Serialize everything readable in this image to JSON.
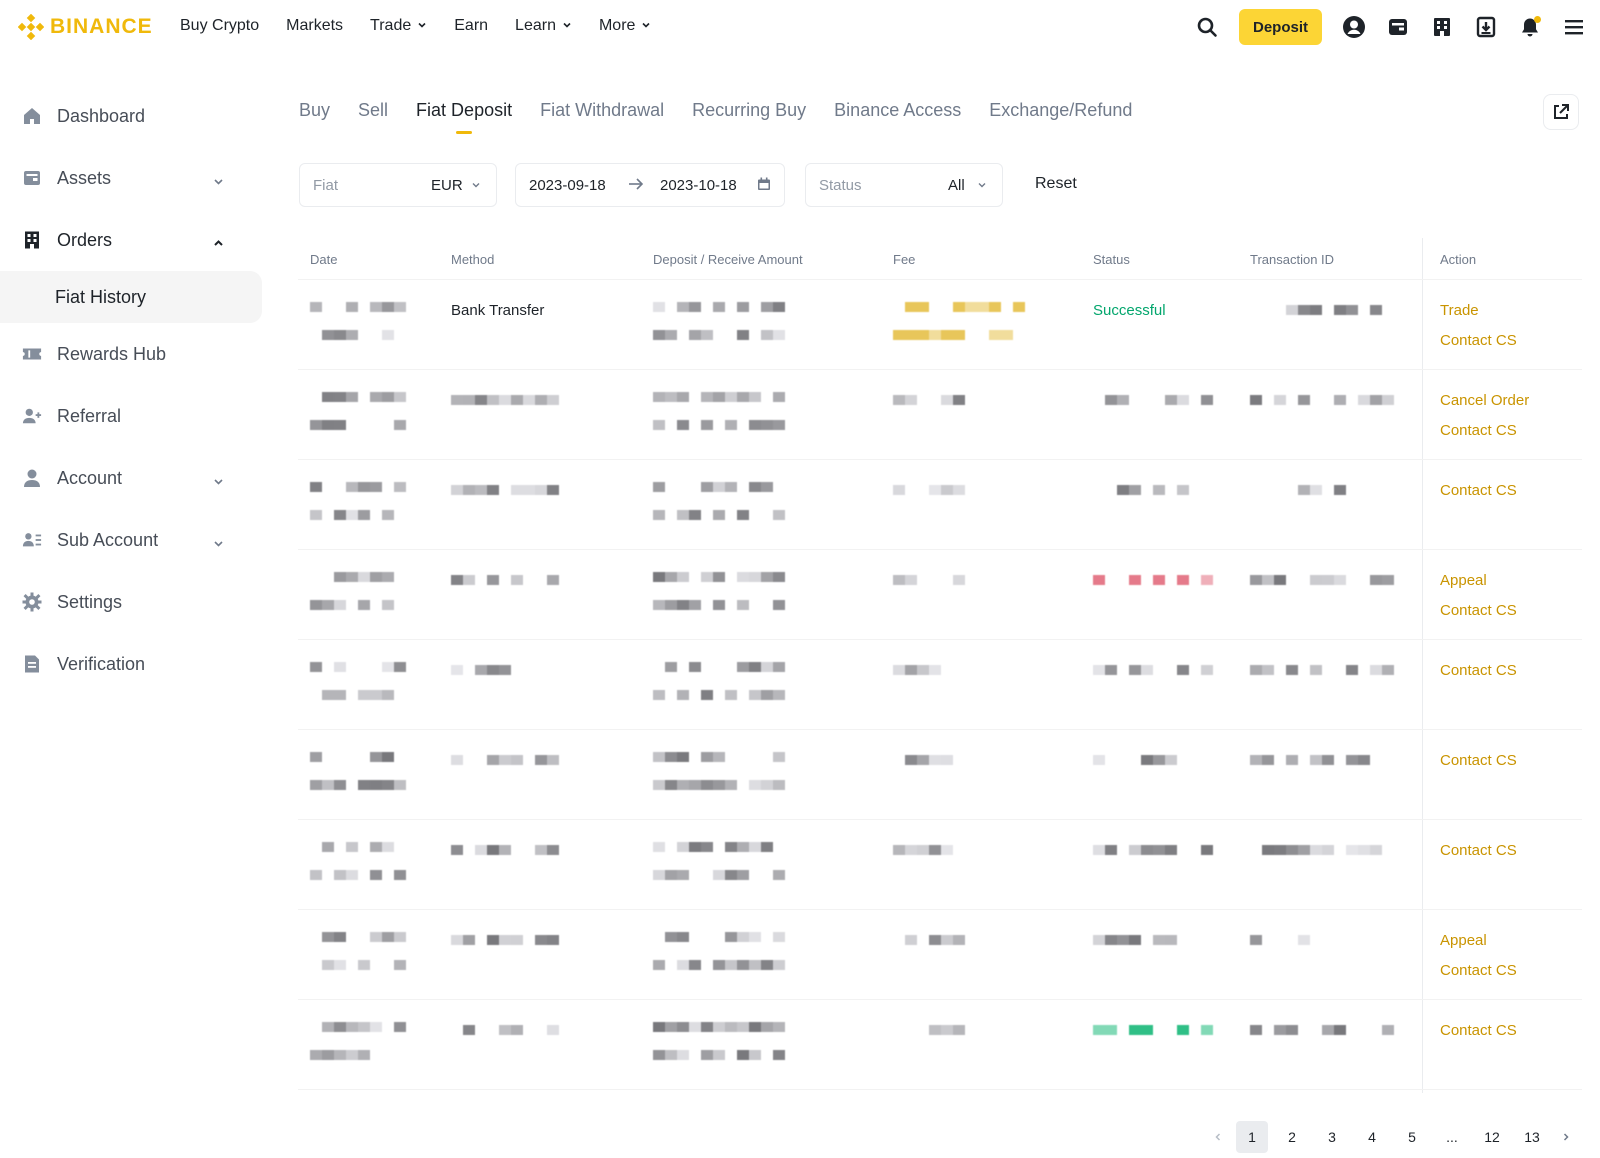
{
  "brand": {
    "name": "BINANCE",
    "color": "#f0b90b"
  },
  "topnav": {
    "links": [
      {
        "label": "Buy Crypto",
        "dropdown": false
      },
      {
        "label": "Markets",
        "dropdown": false
      },
      {
        "label": "Trade",
        "dropdown": true
      },
      {
        "label": "Earn",
        "dropdown": false
      },
      {
        "label": "Learn",
        "dropdown": true
      },
      {
        "label": "More",
        "dropdown": true
      }
    ],
    "deposit_label": "Deposit",
    "icons": [
      "search-icon",
      "user-icon",
      "wallet-icon",
      "orders-icon",
      "download-icon",
      "bell-icon",
      "menu-icon"
    ]
  },
  "sidebar": {
    "items": [
      {
        "label": "Dashboard",
        "icon": "home-icon"
      },
      {
        "label": "Assets",
        "icon": "wallet-icon",
        "caret": "down"
      },
      {
        "label": "Orders",
        "icon": "orders-icon",
        "caret": "up"
      },
      {
        "label": "Rewards Hub",
        "icon": "ticket-icon"
      },
      {
        "label": "Referral",
        "icon": "add-user-icon"
      },
      {
        "label": "Account",
        "icon": "user-icon",
        "caret": "down"
      },
      {
        "label": "Sub Account",
        "icon": "users-icon",
        "caret": "down"
      },
      {
        "label": "Settings",
        "icon": "gear-icon"
      },
      {
        "label": "Verification",
        "icon": "document-icon"
      }
    ],
    "sub_item": "Fiat History"
  },
  "tabs": [
    "Buy",
    "Sell",
    "Fiat Deposit",
    "Fiat Withdrawal",
    "Recurring Buy",
    "Binance Access",
    "Exchange/Refund"
  ],
  "active_tab": "Fiat Deposit",
  "filters": {
    "fiat_label": "Fiat",
    "fiat_value": "EUR",
    "date_from": "2023-09-18",
    "date_to": "2023-10-18",
    "status_label": "Status",
    "status_value": "All",
    "reset_label": "Reset"
  },
  "table": {
    "headers": [
      "Date",
      "Method",
      "Deposit / Receive Amount",
      "Fee",
      "Status",
      "Transaction ID",
      "Action"
    ],
    "rows": [
      {
        "method": "Bank Transfer",
        "status": "Successful",
        "actions": [
          "Trade",
          "Contact CS"
        ]
      },
      {
        "method": "",
        "status": "",
        "actions": [
          "Cancel Order",
          "Contact CS"
        ]
      },
      {
        "method": "",
        "status": "",
        "actions": [
          "Contact CS"
        ]
      },
      {
        "method": "",
        "status": "",
        "actions": [
          "Appeal",
          "Contact CS"
        ]
      },
      {
        "method": "",
        "status": "",
        "actions": [
          "Contact CS"
        ]
      },
      {
        "method": "",
        "status": "",
        "actions": [
          "Contact CS"
        ]
      },
      {
        "method": "",
        "status": "",
        "actions": [
          "Contact CS"
        ]
      },
      {
        "method": "",
        "status": "",
        "actions": [
          "Appeal",
          "Contact CS"
        ]
      },
      {
        "method": "",
        "status": "",
        "actions": [
          "Contact CS"
        ]
      }
    ]
  },
  "pagination": {
    "pages": [
      "1",
      "2",
      "3",
      "4",
      "5",
      "...",
      "12",
      "13"
    ],
    "current": "1"
  },
  "colors": {
    "accent": "#f0b90b",
    "deposit_button": "#fcd535",
    "action_link": "#c99400",
    "success": "#03a66d"
  }
}
